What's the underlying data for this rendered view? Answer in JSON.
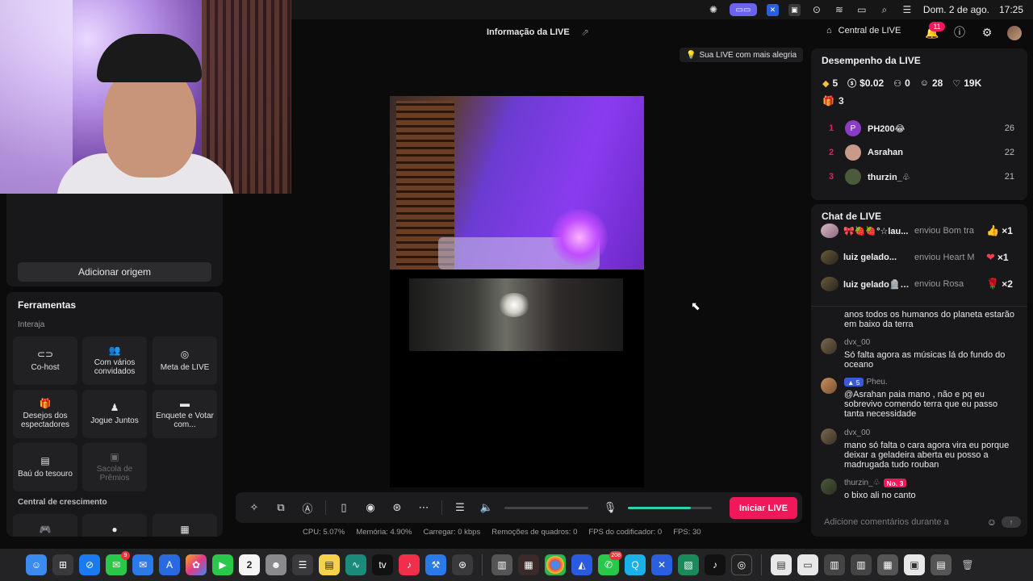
{
  "menubar": {
    "date": "Dom. 2 de ago.",
    "time": "17:25"
  },
  "camera": {
    "label": ""
  },
  "left": {
    "add_source": "Adicionar origem",
    "tools_title": "Ferramentas",
    "interact_label": "Interaja",
    "growth_label": "Central de crescimento",
    "tiles": [
      {
        "label": "Co-host",
        "icon": "link-icon"
      },
      {
        "label": "Com vários convidados",
        "icon": "users-icon"
      },
      {
        "label": "Meta de LIVE",
        "icon": "target-icon"
      },
      {
        "label": "Desejos dos espectadores",
        "icon": "gift-icon"
      },
      {
        "label": "Jogue Juntos",
        "icon": "joystick-icon"
      },
      {
        "label": "Enquete e Votar com...",
        "icon": "poll-icon"
      },
      {
        "label": "Baú do tesouro",
        "icon": "chest-icon"
      },
      {
        "label": "Sacola de Prêmios",
        "icon": "bag-icon"
      }
    ]
  },
  "center": {
    "title": "Informação da LIVE",
    "tip": "Sua LIVE com mais alegria",
    "go_live": "Iniciar LIVE",
    "volume_level": 0.0,
    "mic_level": 0.75,
    "status": {
      "cpu": "CPU: 5.07%",
      "memory": "Memória: 4.90%",
      "upload": "Carregar: 0 kbps",
      "dropped": "Remoções de quadros: 0",
      "encoder": "FPS do codificador: 0",
      "fps": "FPS: 30"
    }
  },
  "header": {
    "creator_center": "Central de LIVE",
    "notifications": "11"
  },
  "performance": {
    "title": "Desempenho da LIVE",
    "diamonds": "5",
    "money": "$0.02",
    "new_followers": "0",
    "viewers": "28",
    "likes": "19K",
    "gifts": "3",
    "ranking": [
      {
        "rank": "1",
        "name": "PH200😂",
        "value": "26",
        "avatar_letter": "P",
        "color": "#8a3cc4"
      },
      {
        "rank": "2",
        "name": "Asrahan",
        "value": "22",
        "avatar_letter": "",
        "color": "#c89a8a"
      },
      {
        "rank": "3",
        "name": "thurzin_♧",
        "value": "21",
        "avatar_letter": "",
        "color": "#4a5a3a"
      }
    ]
  },
  "chat": {
    "title": "Chat de LIVE",
    "gifts": [
      {
        "name": "🎀🍓🍓°☆lau...",
        "sent": "enviou Bom tra",
        "icon": "👍",
        "count": "×1"
      },
      {
        "name": "luiz gelado...",
        "sent": "enviou Heart M",
        "icon": "❤",
        "count": "×1"
      },
      {
        "name": "luiz gelado🪦🪦",
        "sent": "enviou Rosa",
        "icon": "🌹",
        "count": "×2"
      }
    ],
    "messages": [
      {
        "user": "",
        "level": "",
        "rank": "",
        "text": "anos todos os humanos do planeta estarão em baixo da terra"
      },
      {
        "user": "dvx_00",
        "level": "",
        "rank": "",
        "text": "Só falta agora as músicas lá do fundo do oceano"
      },
      {
        "user": "Pheu.",
        "level": "5",
        "rank": "",
        "text": "@Asrahan paia mano , não e pq eu sobrevivo comendo terra que eu passo tanta necessidade"
      },
      {
        "user": "dvx_00",
        "level": "",
        "rank": "",
        "text": "mano só falta o cara agora vira eu porque deixar a geladeira aberta eu posso a madrugada tudo rouban"
      },
      {
        "user": "thurzin_♧",
        "level": "",
        "rank": "No. 3",
        "text": "o bixo ali no canto"
      }
    ],
    "input_placeholder": "Adicione comentários durante a"
  },
  "dock": {
    "calendar_day": "2",
    "messages_badge": "9",
    "whatsapp_badge": "208",
    "tv_label": "tv"
  }
}
